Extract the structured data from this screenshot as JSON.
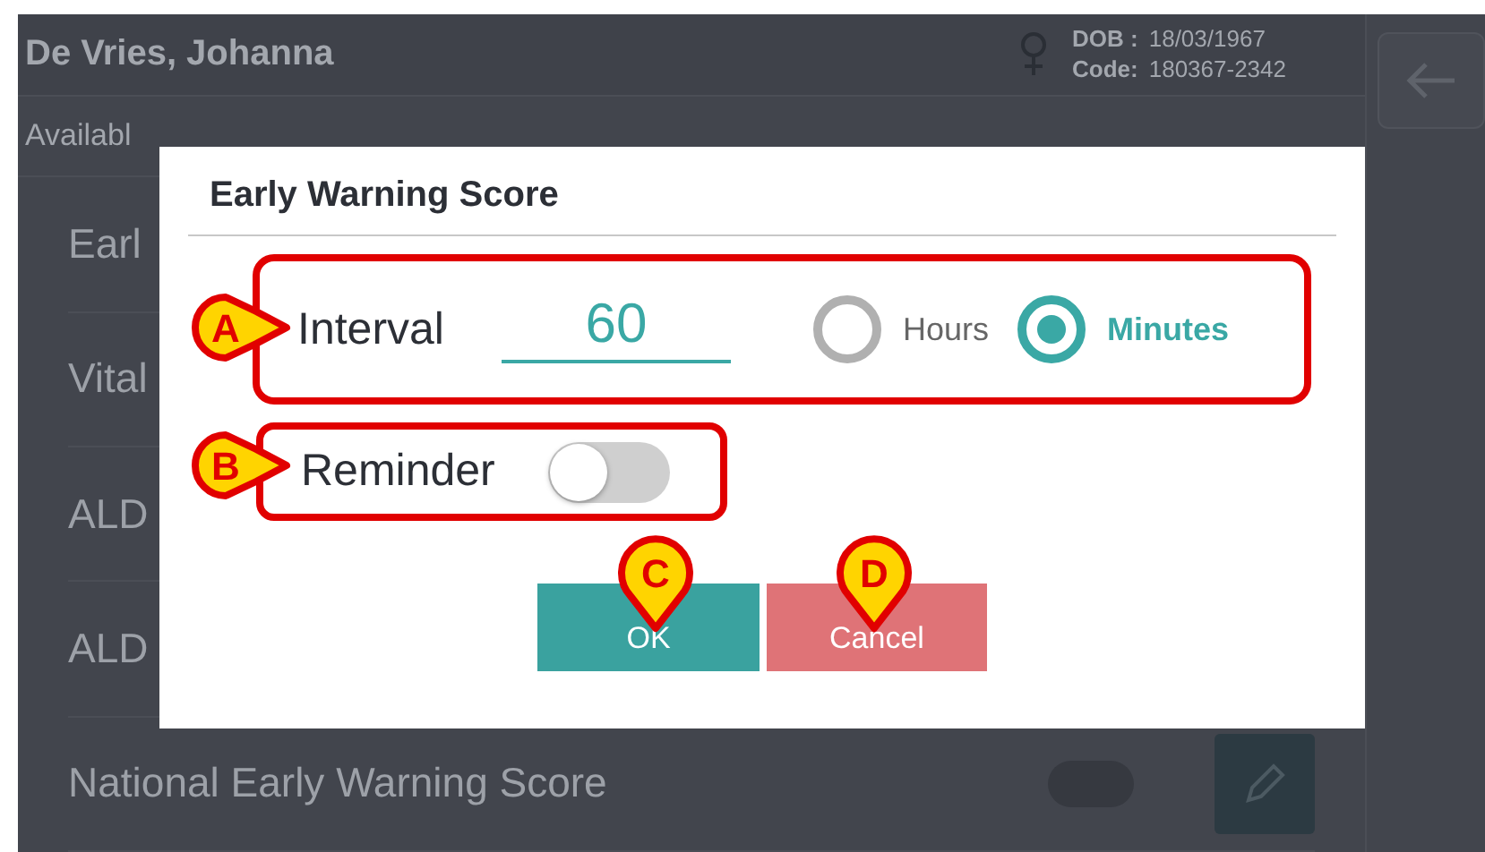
{
  "patient": {
    "name": "De Vries, Johanna",
    "dob_label": "DOB :",
    "dob": "18/03/1967",
    "code_label": "Code:",
    "code": "180367-2342"
  },
  "section_label": "Availabl",
  "rows": [
    {
      "label": "Earl"
    },
    {
      "label": "Vital"
    },
    {
      "label": "ALD"
    },
    {
      "label": "ALD"
    },
    {
      "label": "National Early Warning Score",
      "on": false
    }
  ],
  "dialog": {
    "title": "Early Warning Score",
    "interval_label": "Interval",
    "interval_value": "60",
    "units": [
      {
        "label": "Hours",
        "selected": false
      },
      {
        "label": "Minutes",
        "selected": true
      }
    ],
    "reminder_label": "Reminder",
    "reminder_on": false,
    "buttons": [
      {
        "label": "OK",
        "kind": "confirm"
      },
      {
        "label": "Cancel",
        "kind": "cancel"
      }
    ]
  },
  "callouts": [
    {
      "letter": "A",
      "kind": "right"
    },
    {
      "letter": "B",
      "kind": "right"
    },
    {
      "letter": "C",
      "kind": "down"
    },
    {
      "letter": "D",
      "kind": "down"
    }
  ]
}
